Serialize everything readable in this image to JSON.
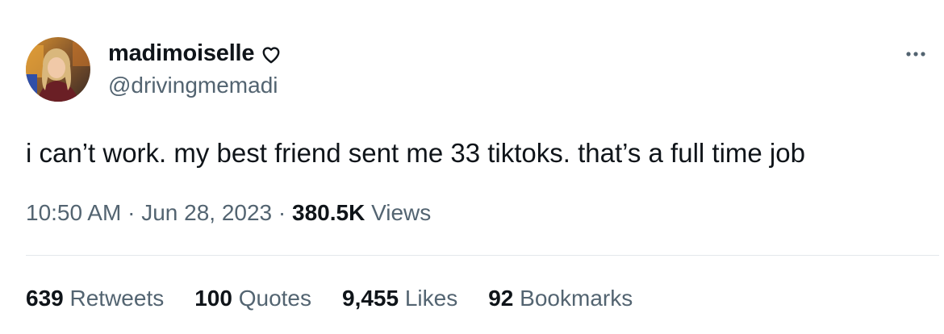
{
  "user": {
    "display_name": "madimoiselle",
    "handle": "@drivingmemadi",
    "badge_icon": "heart-outline-icon"
  },
  "tweet": {
    "text": "i can’t work. my best friend sent me 33 tiktoks. that’s a full time job"
  },
  "meta": {
    "time": "10:50 AM",
    "separator": "·",
    "date": "Jun 28, 2023",
    "views_count": "380.5K",
    "views_label": "Views"
  },
  "stats": [
    {
      "count": "639",
      "label": "Retweets"
    },
    {
      "count": "100",
      "label": "Quotes"
    },
    {
      "count": "9,455",
      "label": "Likes"
    },
    {
      "count": "92",
      "label": "Bookmarks"
    }
  ],
  "more_icon": "more-horizontal-icon",
  "colors": {
    "text_primary": "#0f1419",
    "text_secondary": "#536471",
    "divider": "#e4e8eb",
    "background": "#ffffff"
  }
}
